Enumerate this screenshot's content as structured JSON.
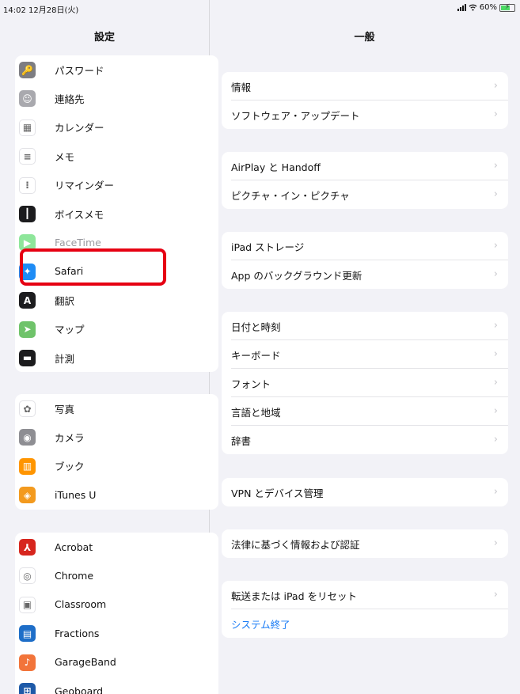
{
  "status_bar": {
    "time": "14:02  12月28日(火)",
    "battery": "60%"
  },
  "sidebar": {
    "title": "設定",
    "groups": [
      [
        {
          "label": "パスワード",
          "icon": "key-icon",
          "color": "#7d7d82"
        },
        {
          "label": "連絡先",
          "icon": "contacts-icon",
          "color": "#a9a9ae"
        },
        {
          "label": "カレンダー",
          "icon": "calendar-icon",
          "color": "#ffffff"
        },
        {
          "label": "メモ",
          "icon": "notes-icon",
          "color": "#ffffff"
        },
        {
          "label": "リマインダー",
          "icon": "reminders-icon",
          "color": "#ffffff"
        },
        {
          "label": "ボイスメモ",
          "icon": "voice-memos-icon",
          "color": "#1c1c1e"
        },
        {
          "label": "FaceTime",
          "icon": "facetime-icon",
          "color": "#8ee69a"
        },
        {
          "label": "Safari",
          "icon": "safari-icon",
          "color": "#1e8cf5"
        },
        {
          "label": "翻訳",
          "icon": "translate-icon",
          "color": "#1c1c1e"
        },
        {
          "label": "マップ",
          "icon": "maps-icon",
          "color": "#6fc36a"
        },
        {
          "label": "計測",
          "icon": "measure-icon",
          "color": "#1c1c1e"
        }
      ],
      [
        {
          "label": "写真",
          "icon": "photos-icon",
          "color": "#ffffff"
        },
        {
          "label": "カメラ",
          "icon": "camera-icon",
          "color": "#8e8e93"
        },
        {
          "label": "ブック",
          "icon": "books-icon",
          "color": "#ff9500"
        },
        {
          "label": "iTunes U",
          "icon": "itunes-u-icon",
          "color": "#f39a1e"
        }
      ],
      [
        {
          "label": "Acrobat",
          "icon": "acrobat-icon",
          "color": "#d7261e"
        },
        {
          "label": "Chrome",
          "icon": "chrome-icon",
          "color": "#ffffff"
        },
        {
          "label": "Classroom",
          "icon": "classroom-icon",
          "color": "#ffffff"
        },
        {
          "label": "Fractions",
          "icon": "fractions-icon",
          "color": "#1e6ec8"
        },
        {
          "label": "GarageBand",
          "icon": "garageband-icon",
          "color": "#f2743a"
        },
        {
          "label": "Geoboard",
          "icon": "geoboard-icon",
          "color": "#1e5aa8"
        }
      ]
    ]
  },
  "main": {
    "title": "一般",
    "groups": [
      [
        "情報",
        "ソフトウェア・アップデート"
      ],
      [
        "AirPlay と Handoff",
        "ピクチャ・イン・ピクチャ"
      ],
      [
        "iPad ストレージ",
        "App のバックグラウンド更新"
      ],
      [
        "日付と時刻",
        "キーボード",
        "フォント",
        "言語と地域",
        "辞書"
      ],
      [
        "VPN とデバイス管理"
      ],
      [
        "法律に基づく情報および認証"
      ],
      [
        "転送または iPad をリセット",
        "システム終了"
      ]
    ]
  },
  "colors": {
    "highlight": "#e60012",
    "link_blue": "#1a7cf5"
  }
}
